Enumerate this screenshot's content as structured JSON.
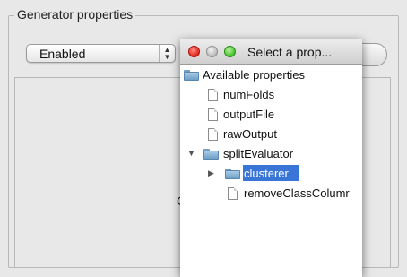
{
  "group": {
    "title": "Generator properties"
  },
  "select": {
    "value": "Enabled",
    "arrows": "▲▼"
  },
  "background": {
    "obscured_char": "C"
  },
  "dialog": {
    "title": "Select a prop...",
    "tree": {
      "root": "Available properties",
      "items": [
        "numFolds",
        "outputFile",
        "rawOutput"
      ],
      "expanded": {
        "label": "splitEvaluator",
        "children": [
          {
            "label": "clusterer",
            "type": "folder",
            "selected": true
          },
          {
            "label": "removeClassColumr",
            "type": "file"
          }
        ]
      }
    }
  },
  "colors": {
    "selection": "#3875d7",
    "folder": "#6e9fc6"
  }
}
